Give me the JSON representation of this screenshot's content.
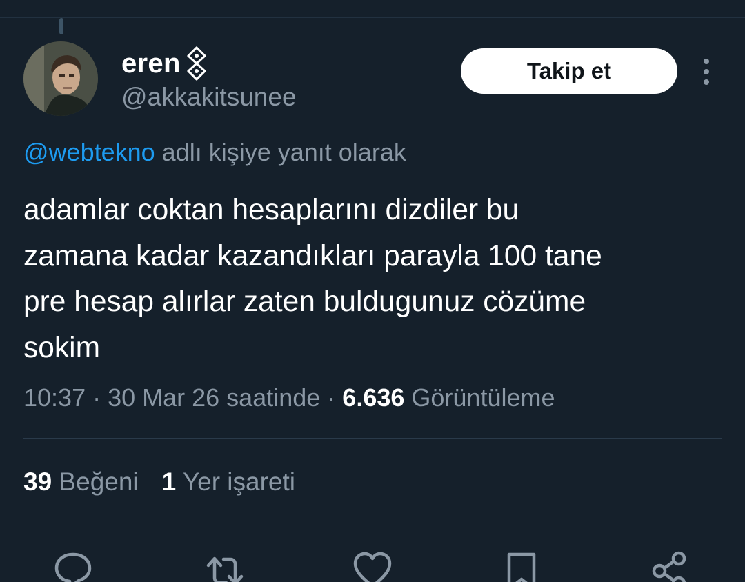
{
  "user": {
    "display_name": "eren",
    "handle": "@akkakitsunee"
  },
  "follow_button": {
    "label": "Takip et"
  },
  "reply_context": {
    "mention": "@webtekno",
    "suffix": " adlı kişiye yanıt olarak"
  },
  "tweet": {
    "lines": [
      "adamlar coktan hesaplarını dizdiler bu",
      "zamana kadar kazandıkları parayla 100 tane",
      "pre hesap alırlar zaten buldugunuz cözüme",
      "sokim"
    ]
  },
  "meta": {
    "time": "10:37",
    "separator": " · ",
    "date": "30 Mar 26 saatinde",
    "views_count": "6.636",
    "views_label": " Görüntüleme"
  },
  "stats": {
    "likes_count": "39",
    "likes_label": " Beğeni",
    "bookmarks_count": "1",
    "bookmarks_label": " Yer işareti"
  },
  "icons": {
    "reply": "reply-icon",
    "retweet": "retweet-icon",
    "like": "heart-icon",
    "bookmark": "bookmark-icon",
    "share": "share-icon",
    "more": "more-vertical-icon"
  },
  "colors": {
    "background": "#15202b",
    "text_primary": "#e7e9ea",
    "text_secondary": "#8b98a5",
    "accent": "#1d9bf0",
    "button_bg": "#ffffff"
  }
}
